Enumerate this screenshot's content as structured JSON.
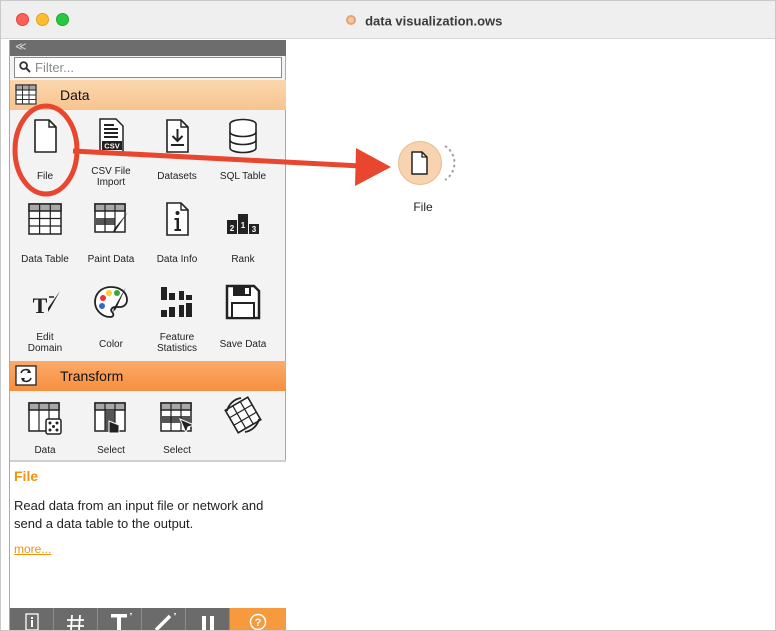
{
  "window": {
    "title": "data visualization.ows"
  },
  "sidebar": {
    "collapse_glyph": "≪",
    "filter_placeholder": "Filter...",
    "categories": [
      {
        "label": "Data",
        "color": "#f7c48f"
      },
      {
        "label": "Transform",
        "color": "#f68f3e"
      }
    ],
    "data_widgets": [
      {
        "label": "File",
        "icon": "file-icon"
      },
      {
        "label": "CSV File\nImport",
        "icon": "csv-file-icon"
      },
      {
        "label": "Datasets",
        "icon": "datasets-download-icon"
      },
      {
        "label": "SQL Table",
        "icon": "database-icon"
      },
      {
        "label": "Data Table",
        "icon": "table-grid-icon"
      },
      {
        "label": "Paint Data",
        "icon": "paint-data-icon"
      },
      {
        "label": "Data Info",
        "icon": "info-icon"
      },
      {
        "label": "Rank",
        "icon": "rank-icon"
      },
      {
        "label": "Edit\nDomain",
        "icon": "edit-domain-icon"
      },
      {
        "label": "Color",
        "icon": "palette-icon"
      },
      {
        "label": "Feature\nStatistics",
        "icon": "bar-statistics-icon"
      },
      {
        "label": "Save Data",
        "icon": "save-icon"
      }
    ],
    "transform_widgets_partial": [
      {
        "label": "Data",
        "icon": "data-sampler-icon"
      },
      {
        "label": "Select",
        "icon": "select-columns-icon"
      },
      {
        "label": "Select",
        "icon": "select-rows-icon"
      },
      {
        "label": "",
        "icon": "transpose-icon"
      }
    ],
    "info_panel": {
      "title": "File",
      "description": "Read data from an input file or network and send a data table to the output.",
      "more_link": "more..."
    },
    "bottom_tools": [
      "info-icon",
      "grid-hash-icon",
      "text-tool-icon",
      "pen-tool-icon",
      "pause-icon",
      "help-icon"
    ]
  },
  "canvas": {
    "nodes": [
      {
        "label": "File",
        "icon": "file-icon"
      }
    ]
  },
  "annotation": {
    "color": "#e8462e"
  }
}
